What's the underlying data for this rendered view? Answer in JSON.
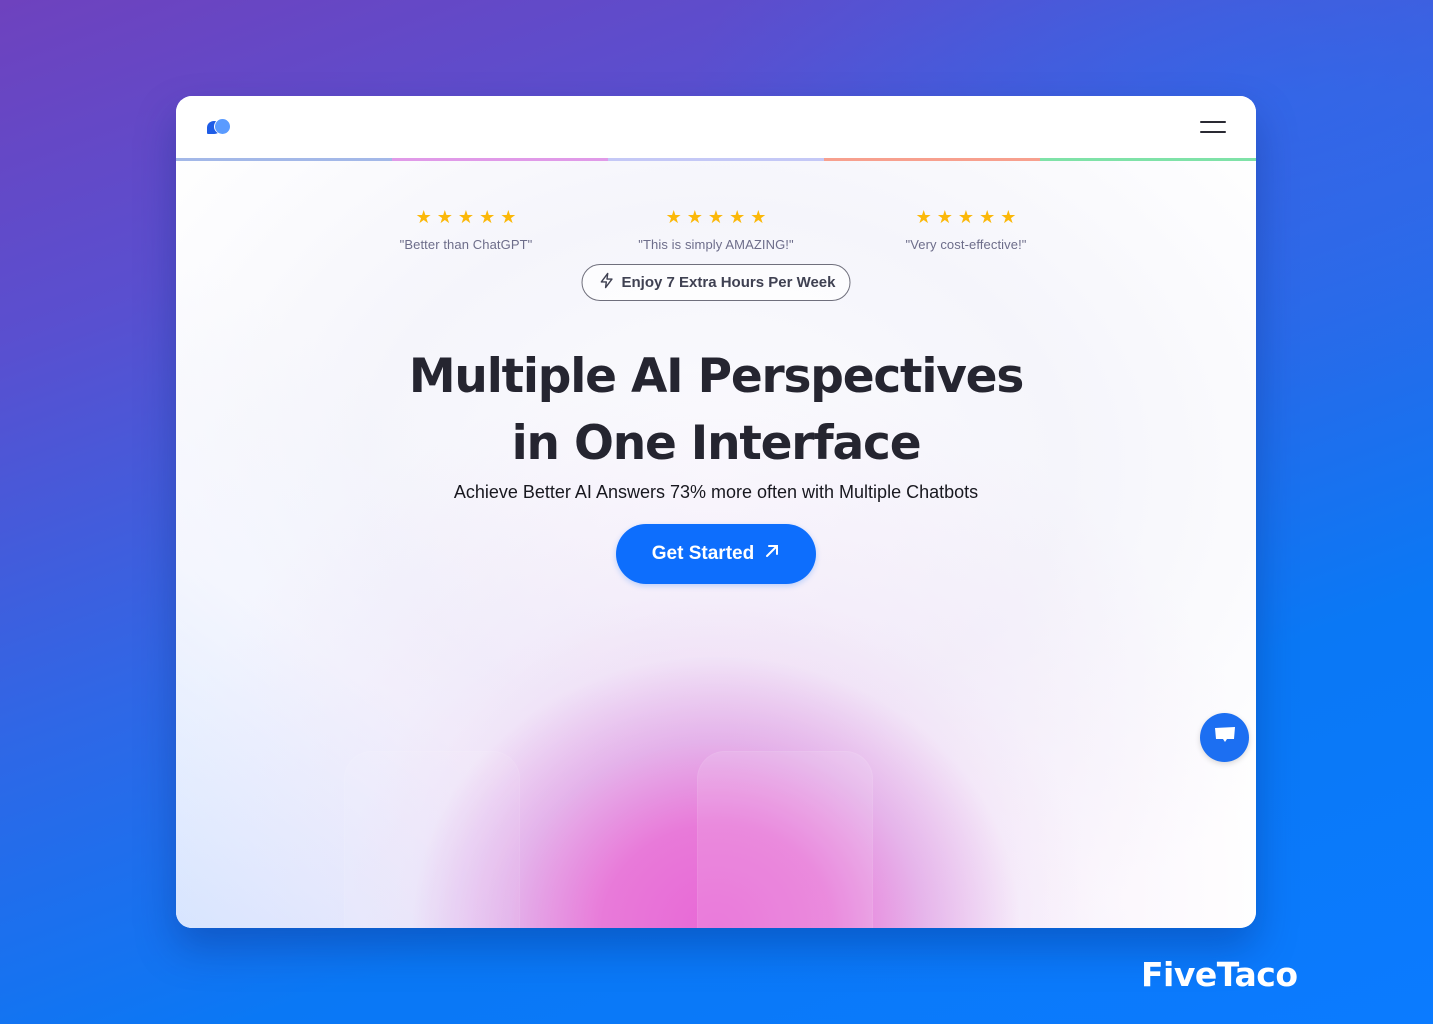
{
  "navbar": {
    "logo_icon": "chat-bubbles-logo-icon",
    "menu_icon": "hamburger-menu-icon",
    "divider_colors": [
      "#a3b8e8",
      "#e09ae8",
      "#c4c8f6",
      "#f7a08e",
      "#7fe2a8"
    ]
  },
  "reviews": [
    {
      "rating": 5,
      "quote": "\"Better than ChatGPT\""
    },
    {
      "rating": 5,
      "quote": "\"This is simply AMAZING!\""
    },
    {
      "rating": 5,
      "quote": "\"Very cost-effective!\""
    }
  ],
  "star_glyph": "★",
  "star_color": "#fbb809",
  "badge": {
    "icon": "lightning-bolt-icon",
    "label": "Enjoy 7 Extra Hours Per Week"
  },
  "hero": {
    "headline_line1": "Multiple AI Perspectives",
    "headline_line2": "in One Interface",
    "subheadline": "Achieve Better AI Answers 73% more often with Multiple Chatbots",
    "cta_label": "Get Started",
    "cta_icon": "arrow-up-right-icon",
    "cta_color": "#0d6efd"
  },
  "chat_widget": {
    "icon": "chat-message-icon",
    "color": "#1c6ff2"
  },
  "brand": {
    "name": "FiveTaco"
  }
}
